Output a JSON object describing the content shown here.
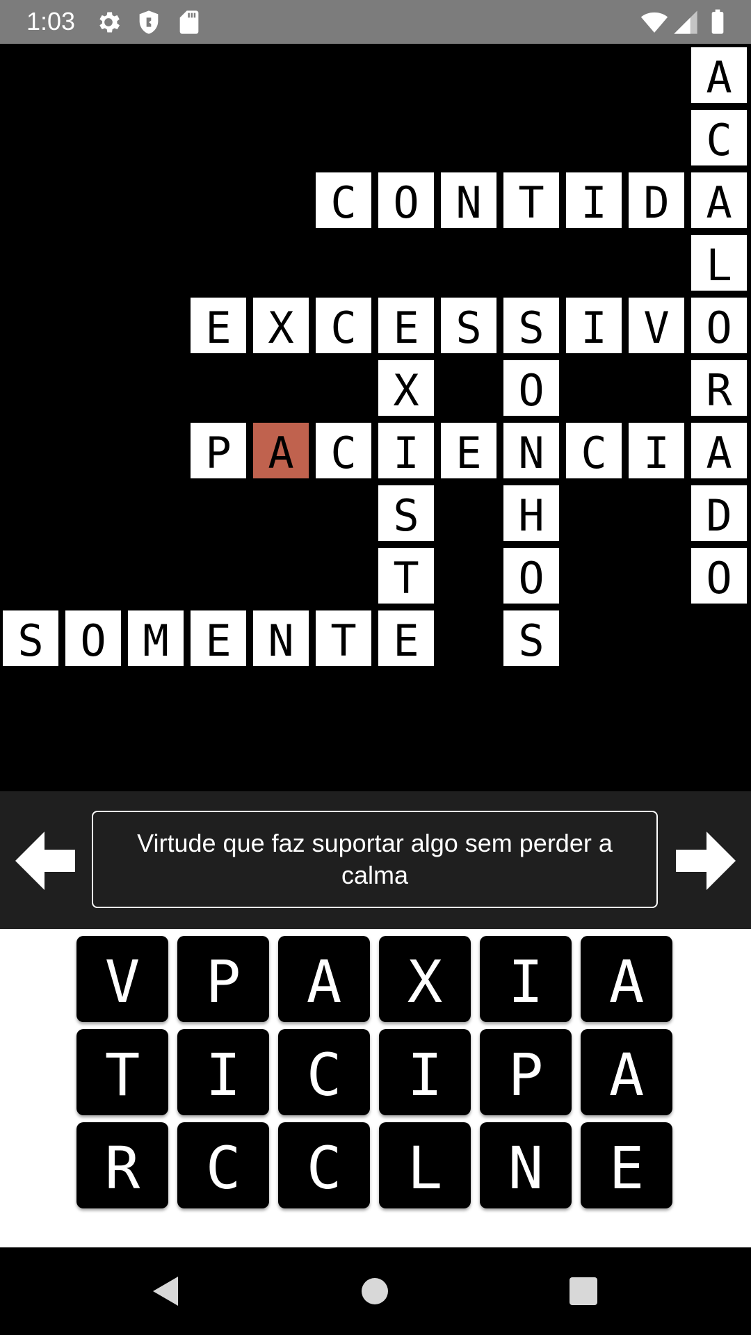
{
  "status": {
    "time": "1:03",
    "icons_left": [
      "settings-icon",
      "shield-icon",
      "sd-card-icon"
    ],
    "icons_right": [
      "wifi-icon",
      "signal-icon",
      "battery-icon"
    ]
  },
  "grid": {
    "active_color": "#c0624e",
    "cells": {
      "acalorado": [
        "A",
        "C",
        "A",
        "L",
        "O",
        "R",
        "A",
        "D",
        "O"
      ],
      "contida": [
        "C",
        "O",
        "N",
        "T",
        "I",
        "D"
      ],
      "excessivo": [
        "E",
        "X",
        "C",
        "E",
        "S",
        "S",
        "I",
        "V"
      ],
      "existe": [
        "X",
        "I",
        "S",
        "T",
        "E"
      ],
      "sonhos": [
        "O",
        "N",
        "H",
        "O",
        "S"
      ],
      "paciencia": [
        "P",
        "A",
        "C",
        "E",
        "C",
        "I"
      ],
      "somente": [
        "S",
        "O",
        "M",
        "E",
        "N",
        "T"
      ]
    }
  },
  "clue": {
    "text": "Virtude que faz suportar algo sem perder a calma",
    "prev_label": "previous-clue",
    "next_label": "next-clue"
  },
  "keyboard": {
    "rows": [
      [
        "V",
        "P",
        "A",
        "X",
        "I",
        "A"
      ],
      [
        "T",
        "I",
        "C",
        "I",
        "P",
        "A"
      ],
      [
        "R",
        "C",
        "C",
        "L",
        "N",
        "E"
      ]
    ]
  },
  "navbar": {
    "buttons": [
      "back-icon",
      "home-icon",
      "recents-icon"
    ]
  }
}
